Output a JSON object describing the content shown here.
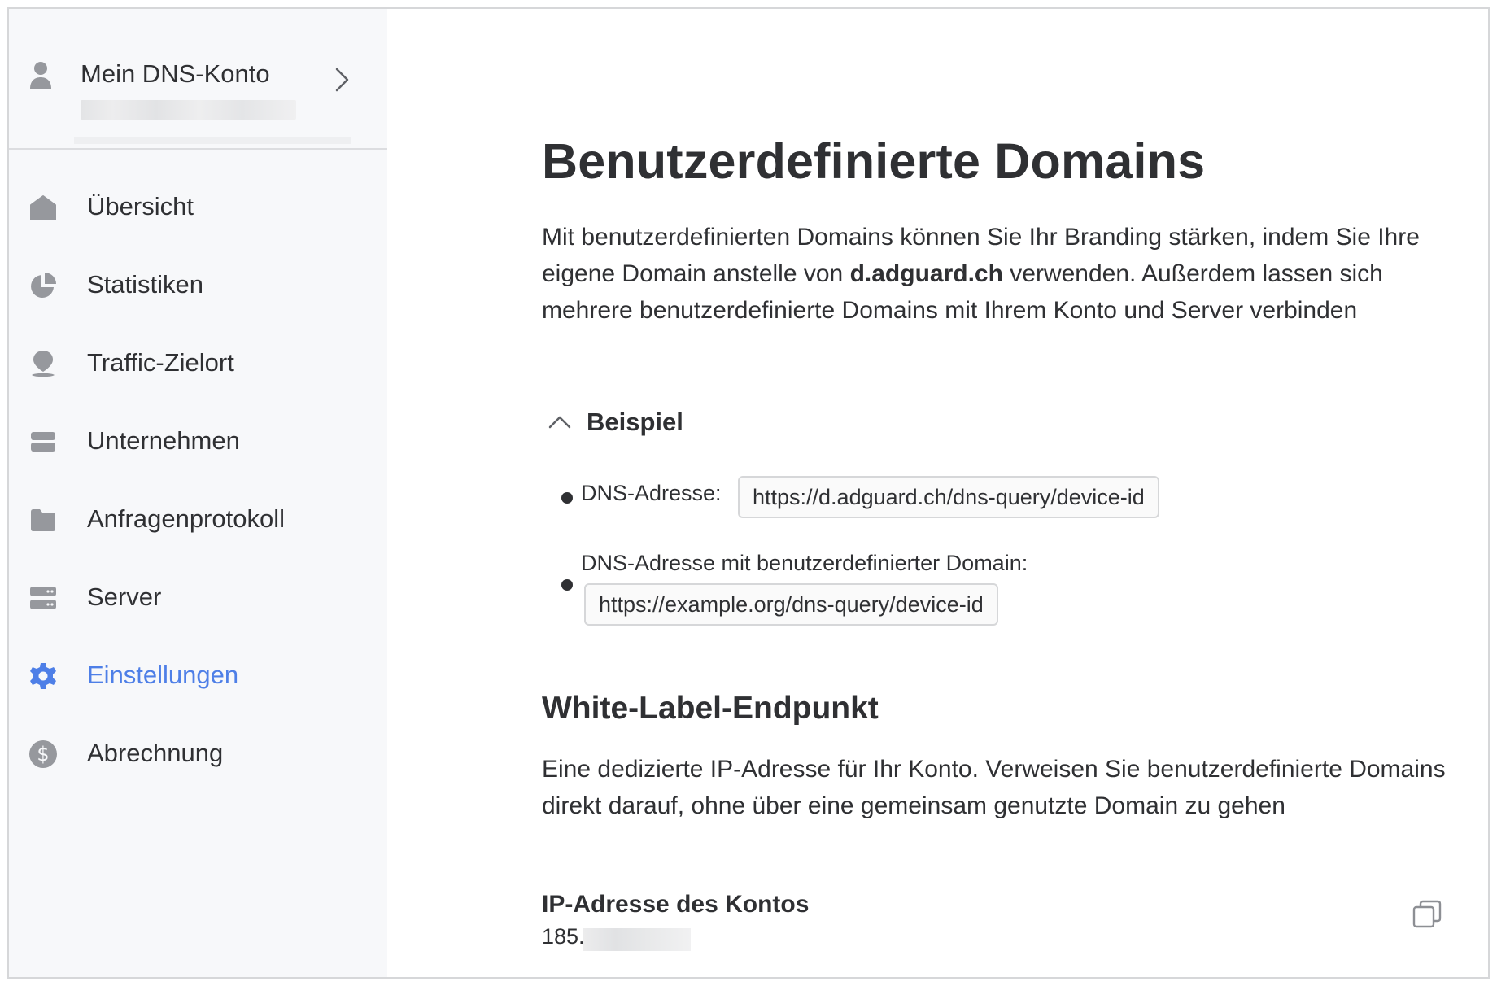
{
  "colors": {
    "accent": "#4e7fe7",
    "icon_gray": "#96989d",
    "text": "#2f3033",
    "sidebar_bg": "#f7f8fa"
  },
  "account": {
    "name": "Mein DNS-Konto"
  },
  "nav": {
    "items": [
      {
        "label": "Übersicht",
        "icon": "home-icon"
      },
      {
        "label": "Statistiken",
        "icon": "pie-chart-icon"
      },
      {
        "label": "Traffic-Zielort",
        "icon": "location-pin-icon"
      },
      {
        "label": "Unternehmen",
        "icon": "company-card-icon"
      },
      {
        "label": "Anfragenprotokoll",
        "icon": "folder-icon"
      },
      {
        "label": "Server",
        "icon": "server-icon"
      },
      {
        "label": "Einstellungen",
        "icon": "gear-icon",
        "active": true
      },
      {
        "label": "Abrechnung",
        "icon": "dollar-icon"
      }
    ]
  },
  "main": {
    "title": "Benutzerdefinierte Domains",
    "intro_part1": "Mit benutzerdefinierten Domains können Sie Ihr Branding stärken, indem Sie Ihre eigene Domain anstelle von ",
    "intro_bold": "d.adguard.ch",
    "intro_part2": " verwenden. Außerdem lassen sich mehrere benutzerdefinierte Domains mit Ihrem Konto und Server verbinden",
    "example": {
      "toggle_label": "Beispiel",
      "dns_label": "DNS-Adresse:",
      "dns_value": "https://d.adguard.ch/dns-query/device-id",
      "custom_label": "DNS-Adresse mit benutzerdefinierter Domain:",
      "custom_value": "https://example.org/dns-query/device-id"
    },
    "whitelabel": {
      "title": "White-Label-Endpunkt",
      "description": "Eine dedizierte IP-Adresse für Ihr Konto. Verweisen Sie benutzerdefinierte Domains direkt darauf, ohne über eine gemeinsam genutzte Domain zu gehen",
      "ip_label": "IP-Adresse des Kontos",
      "ip_value": "185."
    }
  }
}
